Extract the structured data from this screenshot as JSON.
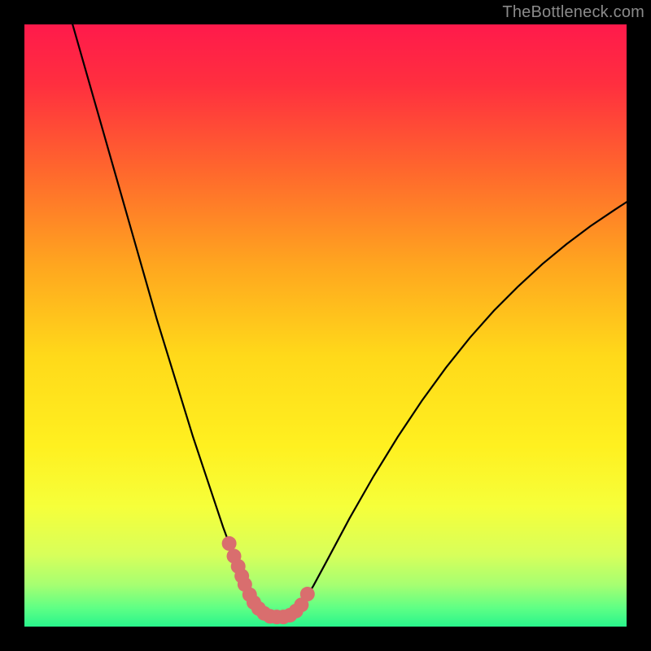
{
  "watermark": "TheBottleneck.com",
  "gradient": {
    "stops": [
      {
        "offset": 0.0,
        "color": "#ff1a4b"
      },
      {
        "offset": 0.1,
        "color": "#ff2f3f"
      },
      {
        "offset": 0.25,
        "color": "#ff6a2c"
      },
      {
        "offset": 0.4,
        "color": "#ffa61f"
      },
      {
        "offset": 0.55,
        "color": "#ffd91a"
      },
      {
        "offset": 0.7,
        "color": "#fff020"
      },
      {
        "offset": 0.8,
        "color": "#f6ff3a"
      },
      {
        "offset": 0.88,
        "color": "#d8ff5a"
      },
      {
        "offset": 0.93,
        "color": "#a7ff71"
      },
      {
        "offset": 0.97,
        "color": "#5dff85"
      },
      {
        "offset": 1.0,
        "color": "#29f58c"
      }
    ]
  },
  "point_color": "#d96e6e",
  "point_radius": 9,
  "chart_data": {
    "type": "line",
    "title": "",
    "xlabel": "",
    "ylabel": "",
    "xlim": [
      0,
      100
    ],
    "ylim": [
      0,
      100
    ],
    "series": [
      {
        "name": "curve",
        "x": [
          8,
          10,
          12,
          14,
          16,
          18,
          20,
          22,
          24,
          26,
          28,
          30,
          32,
          33,
          34,
          35,
          36,
          37,
          38,
          39,
          40,
          41,
          42,
          43,
          44,
          45,
          46,
          48,
          50,
          54,
          58,
          62,
          66,
          70,
          74,
          78,
          82,
          86,
          90,
          94,
          98,
          100
        ],
        "y": [
          100,
          93,
          86,
          79,
          72,
          65,
          58,
          51,
          44.5,
          38,
          31.5,
          25.5,
          19.5,
          16.5,
          13.8,
          11.2,
          8.8,
          6.6,
          4.8,
          3.4,
          2.4,
          1.8,
          1.6,
          1.6,
          1.8,
          2.4,
          3.5,
          6.8,
          10.5,
          18,
          25,
          31.5,
          37.5,
          43,
          48,
          52.5,
          56.5,
          60.2,
          63.5,
          66.5,
          69.2,
          70.5
        ]
      }
    ],
    "points": [
      {
        "x": 34.0,
        "y": 13.8
      },
      {
        "x": 34.8,
        "y": 11.7
      },
      {
        "x": 35.5,
        "y": 10.0
      },
      {
        "x": 36.1,
        "y": 8.4
      },
      {
        "x": 36.6,
        "y": 7.0
      },
      {
        "x": 37.4,
        "y": 5.3
      },
      {
        "x": 38.1,
        "y": 4.0
      },
      {
        "x": 38.9,
        "y": 3.0
      },
      {
        "x": 39.8,
        "y": 2.2
      },
      {
        "x": 40.8,
        "y": 1.7
      },
      {
        "x": 41.9,
        "y": 1.6
      },
      {
        "x": 43.0,
        "y": 1.6
      },
      {
        "x": 44.1,
        "y": 1.9
      },
      {
        "x": 45.1,
        "y": 2.6
      },
      {
        "x": 46.0,
        "y": 3.6
      },
      {
        "x": 47.0,
        "y": 5.4
      }
    ]
  }
}
